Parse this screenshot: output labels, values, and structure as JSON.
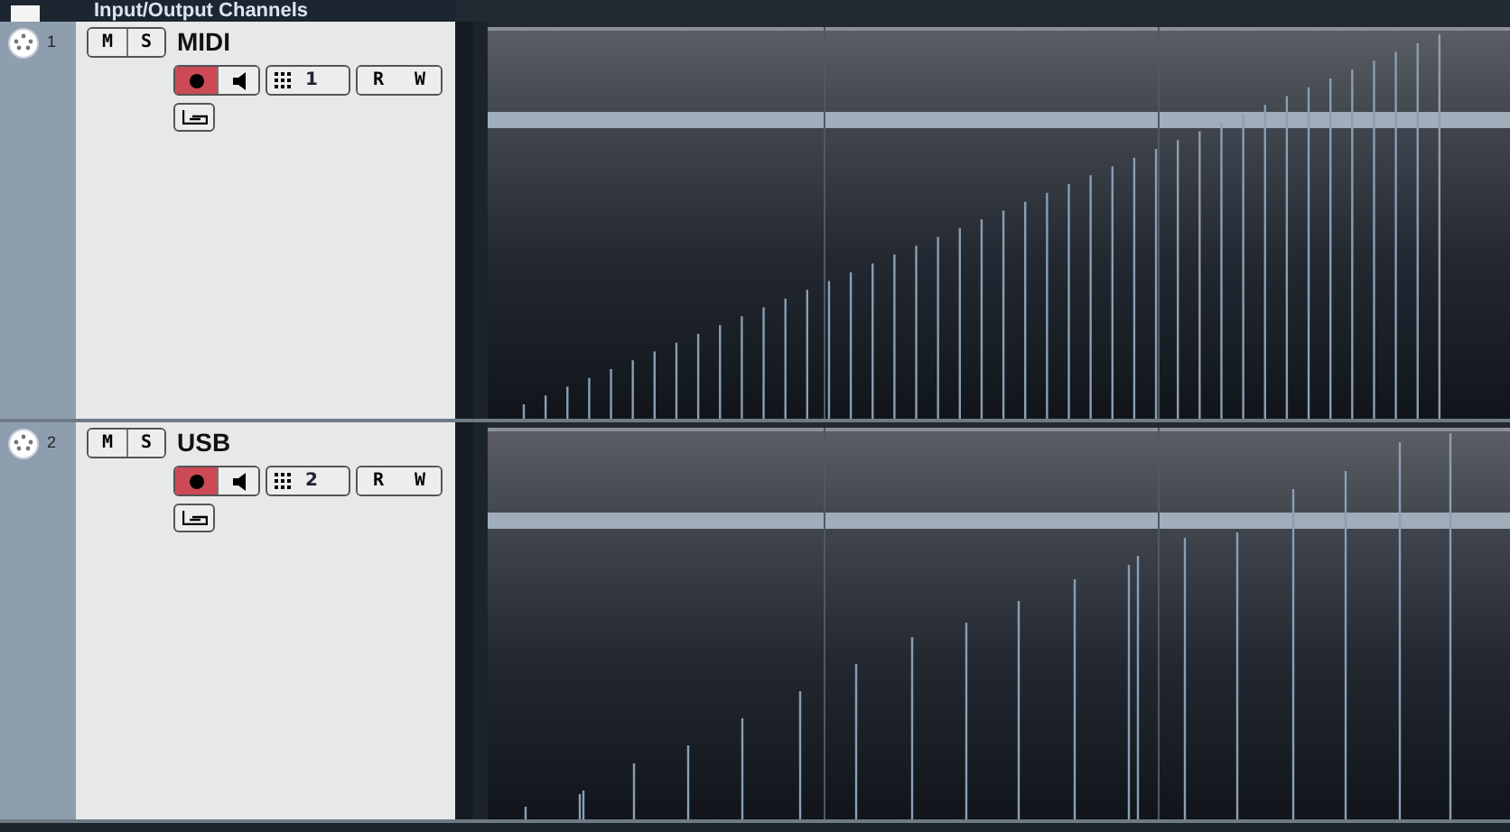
{
  "header": {
    "title": "Input/Output Channels",
    "checked": false
  },
  "tracks": [
    {
      "number": "1",
      "name": "MIDI",
      "mute": {
        "label": "M",
        "on": false
      },
      "solo": {
        "label": "S",
        "on": false
      },
      "record": true,
      "monitor": false,
      "channel": "1",
      "read": {
        "label": "R",
        "on": false
      },
      "write": {
        "label": "W",
        "on": false
      },
      "selected": false
    },
    {
      "number": "2",
      "name": "USB",
      "mute": {
        "label": "M",
        "on": false
      },
      "solo": {
        "label": "S",
        "on": false
      },
      "record": true,
      "monitor": false,
      "channel": "2",
      "read": {
        "label": "R",
        "on": false
      },
      "write": {
        "label": "W",
        "on": false
      },
      "selected": false
    }
  ]
}
